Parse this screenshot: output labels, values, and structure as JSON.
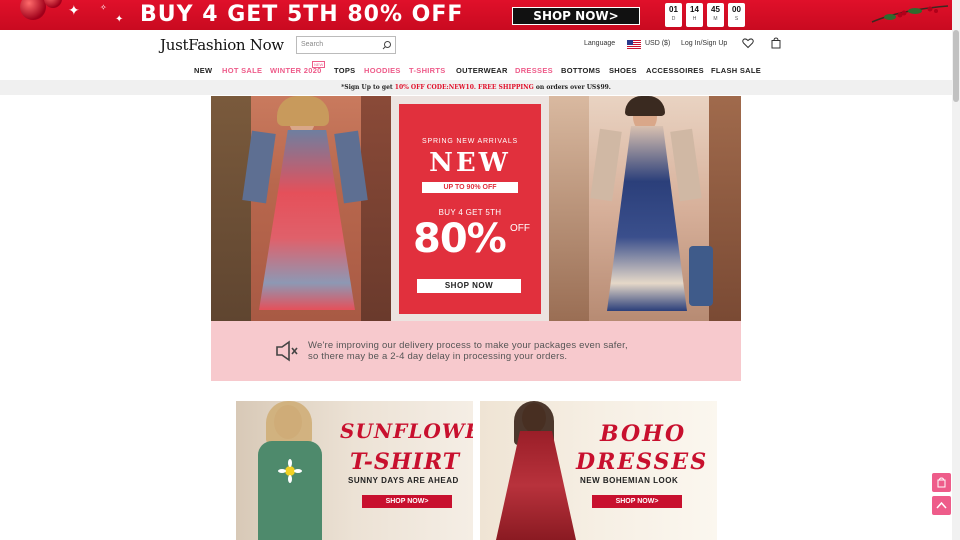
{
  "promo": {
    "text": "BUY 4 GET 5TH 80% OFF",
    "shop_label": "SHOP NOW>",
    "countdown": [
      {
        "value": "01",
        "unit": "D"
      },
      {
        "value": "14",
        "unit": "H"
      },
      {
        "value": "45",
        "unit": "M"
      },
      {
        "value": "00",
        "unit": "S"
      }
    ]
  },
  "header": {
    "logo": "JustFashion Now",
    "search_placeholder": "Search",
    "language": "Language",
    "currency": "USD ($)",
    "account": "Log In/Sign Up"
  },
  "nav": {
    "items": [
      {
        "label": "NEW",
        "highlight": false
      },
      {
        "label": "HOT SALE",
        "highlight": true
      },
      {
        "label": "WINTER 2020",
        "highlight": true
      },
      {
        "label": "TOPS",
        "highlight": false
      },
      {
        "label": "HOODIES",
        "highlight": true
      },
      {
        "label": "T-SHIRTS",
        "highlight": true
      },
      {
        "label": "OUTERWEAR",
        "highlight": false
      },
      {
        "label": "DRESSES",
        "highlight": true
      },
      {
        "label": "BOTTOMS",
        "highlight": false
      },
      {
        "label": "SHOES",
        "highlight": false
      },
      {
        "label": "ACCESSOIRES",
        "highlight": false
      },
      {
        "label": "FLASH SALE",
        "highlight": false
      }
    ],
    "winter_badge": "NEW"
  },
  "notice": {
    "prefix": "*Sign Up to get",
    "offer": "10% OFF CODE:NEW10. FREE SHIPPING",
    "suffix": "on orders over US$99."
  },
  "hero": {
    "subtitle": "SPRING NEW ARRIVALS",
    "title": "NEW",
    "upto": "UP TO 90% OFF",
    "buy": "BUY 4 GET 5TH",
    "percent": "80%",
    "off": "OFF",
    "shop_label": "SHOP NOW"
  },
  "delivery": {
    "line1": "We're improving our delivery process to make your packages even safer,",
    "line2": "so there may be a 2-4 day delay in processing your orders."
  },
  "tiles": [
    {
      "title1": "SUNFLOWER",
      "title2": "T-SHIRT",
      "subtitle": "SUNNY DAYS ARE AHEAD",
      "shop_label": "SHOP NOW>"
    },
    {
      "title1": "BOHO",
      "title2": "DRESSES",
      "subtitle": "NEW BOHEMIAN LOOK",
      "shop_label": "SHOP NOW>"
    }
  ],
  "colors": {
    "brand_red": "#e0102a",
    "accent_pink": "#ee5c8a",
    "notice_bg": "#f7c9cd"
  }
}
